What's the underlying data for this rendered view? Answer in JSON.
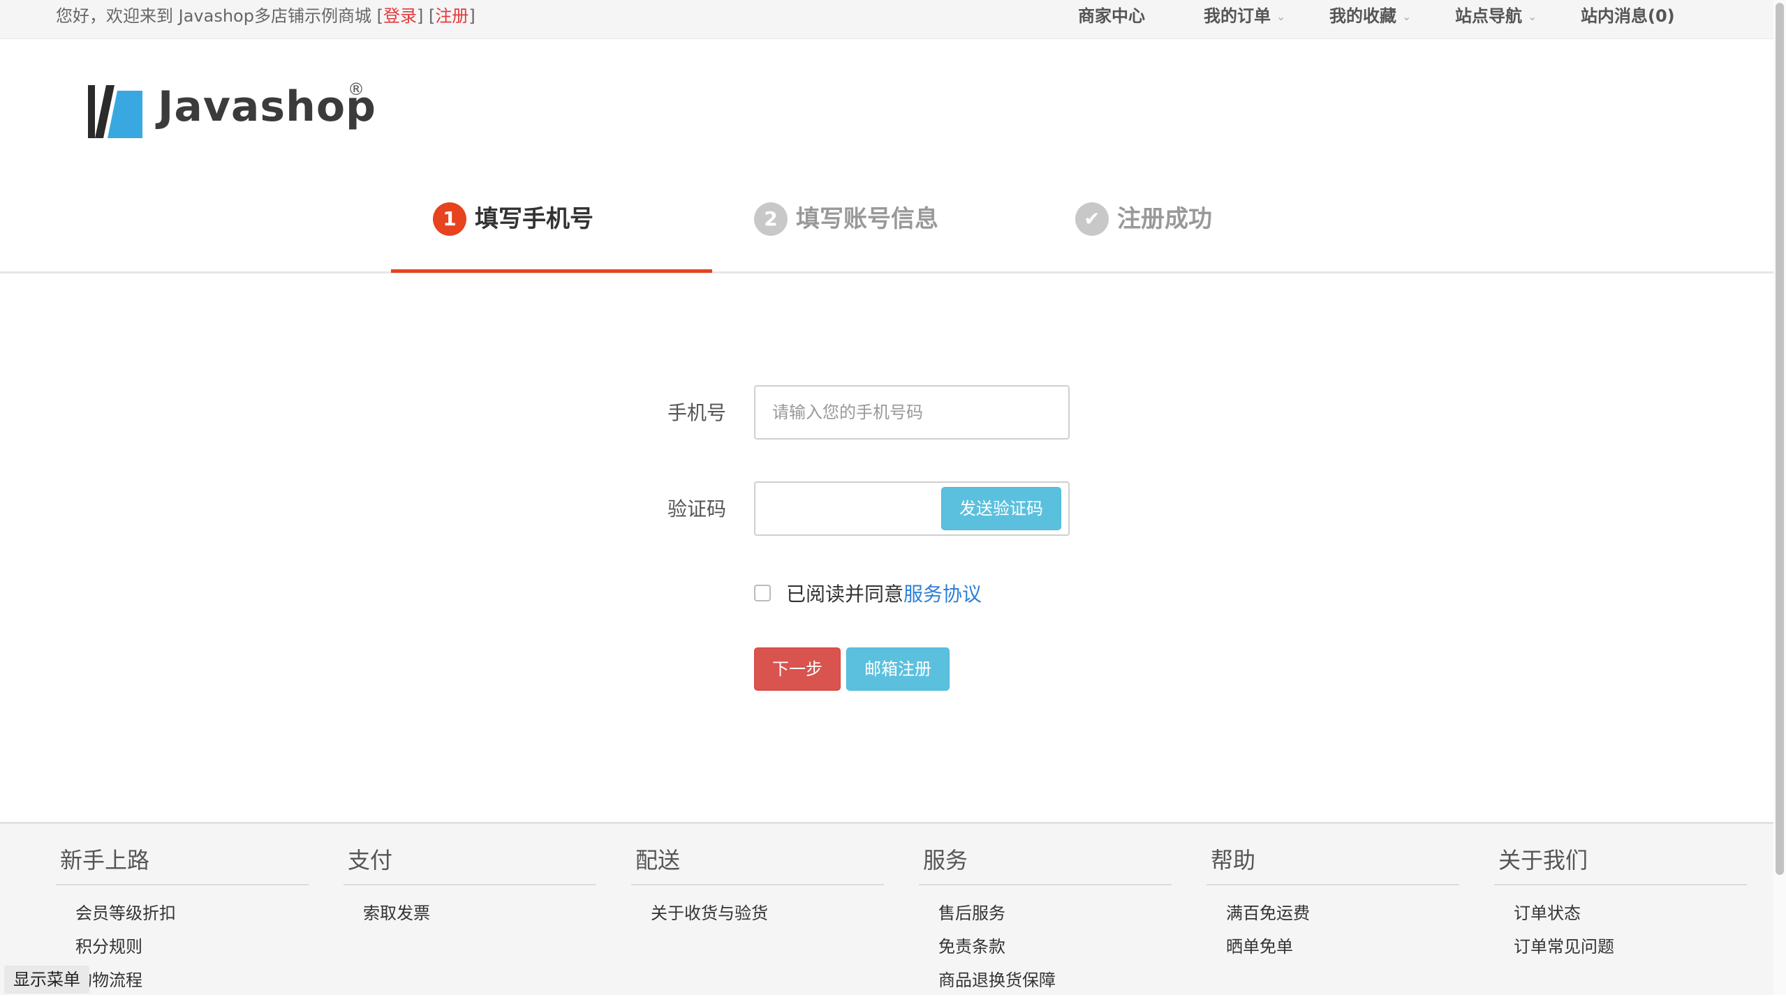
{
  "topbar": {
    "welcome_prefix": "您好，欢迎来到 Javashop多店铺示例商城 [",
    "login": "登录",
    "mid": "] [",
    "register": "注册",
    "suffix": "]",
    "nav": [
      {
        "label": "商家中心",
        "dropdown": false
      },
      {
        "label": "我的订单",
        "dropdown": true
      },
      {
        "label": "我的收藏",
        "dropdown": true
      },
      {
        "label": "站点导航",
        "dropdown": true
      },
      {
        "label": "站内消息(0)",
        "dropdown": false
      }
    ],
    "caret": "⌄"
  },
  "logo": {
    "text": "Javashop",
    "reg": "®",
    "colors": {
      "dark": "#2b2b2b",
      "blue": "#3aa8e0"
    }
  },
  "steps": [
    {
      "num": "1",
      "label": "填写手机号",
      "state": "active"
    },
    {
      "num": "2",
      "label": "填写账号信息",
      "state": "inactive"
    },
    {
      "num": "✔",
      "label": "注册成功",
      "state": "inactive"
    }
  ],
  "form": {
    "phone_label": "手机号",
    "phone_placeholder": "请输入您的手机号码",
    "phone_value": "",
    "code_label": "验证码",
    "code_value": "",
    "send_code": "发送验证码",
    "agree_text": "已阅读并同意",
    "agree_link": "服务协议",
    "agree_checked": false,
    "next": "下一步",
    "email_register": "邮箱注册"
  },
  "footer": {
    "columns": [
      {
        "title": "新手上路",
        "items": [
          "会员等级折扣",
          "积分规则",
          "购物流程"
        ]
      },
      {
        "title": "支付",
        "items": [
          "索取发票"
        ]
      },
      {
        "title": "配送",
        "items": [
          "关于收货与验货"
        ]
      },
      {
        "title": "服务",
        "items": [
          "售后服务",
          "免责条款",
          "商品退换货保障"
        ]
      },
      {
        "title": "帮助",
        "items": [
          "满百免运费",
          "晒单免单"
        ]
      },
      {
        "title": "关于我们",
        "items": [
          "订单状态",
          "订单常见问题"
        ]
      }
    ]
  },
  "show_menu": "显示菜单",
  "colors": {
    "accent_red": "#e6431e",
    "link_blue": "#2d7fd8",
    "btn_info": "#5bc0de",
    "btn_danger": "#d9534f"
  }
}
